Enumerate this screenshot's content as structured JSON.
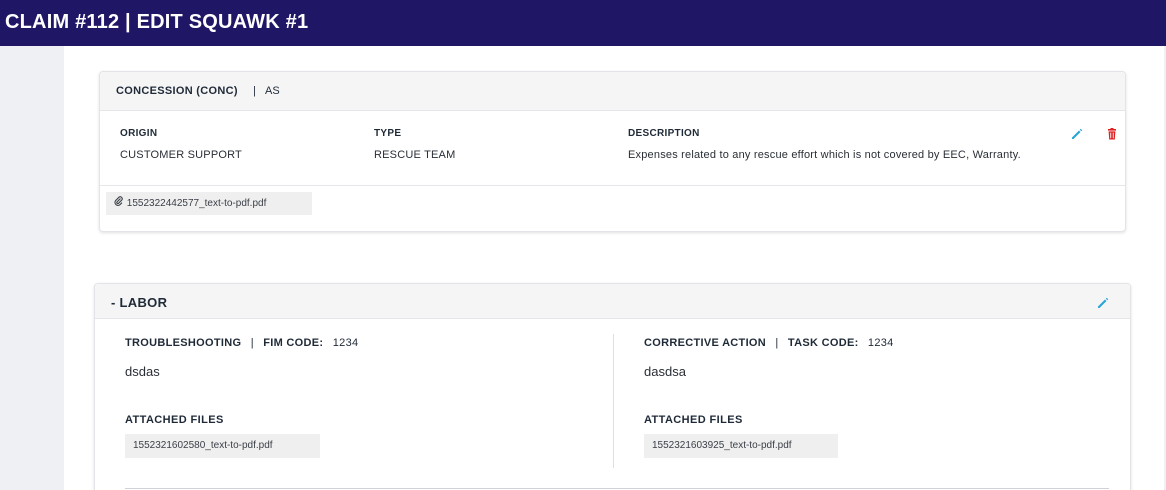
{
  "header": {
    "title": "CLAIM #112 | EDIT SQUAWK #1"
  },
  "concession": {
    "title": "CONCESSION (CONC)",
    "separator": "|",
    "code": "AS",
    "origin_label": "ORIGIN",
    "origin_value": "CUSTOMER SUPPORT",
    "type_label": "TYPE",
    "type_value": "RESCUE TEAM",
    "description_label": "DESCRIPTION",
    "description_value": "Expenses related to any rescue effort which is not covered by EEC, Warranty.",
    "attachment": "1552322442577_text-to-pdf.pdf",
    "edit_icon": "pencil-icon",
    "delete_icon": "trash-icon"
  },
  "labor": {
    "title": "- LABOR",
    "edit_icon": "pencil-icon",
    "troubleshooting": {
      "label": "TROUBLESHOOTING",
      "separator": "|",
      "code_label": "FIM CODE:",
      "code_value": "1234",
      "text": "dsdas",
      "attached_label": "ATTACHED FILES",
      "file": "1552321602580_text-to-pdf.pdf"
    },
    "corrective": {
      "label": "CORRECTIVE ACTION",
      "separator": "|",
      "code_label": "TASK CODE:",
      "code_value": "1234",
      "text": "dasdsa",
      "attached_label": "ATTACHED FILES",
      "file": "1552321603925_text-to-pdf.pdf"
    }
  },
  "colors": {
    "header_bg": "#1f1766",
    "edit_icon": "#2aa6d6",
    "delete_icon": "#e02020"
  }
}
